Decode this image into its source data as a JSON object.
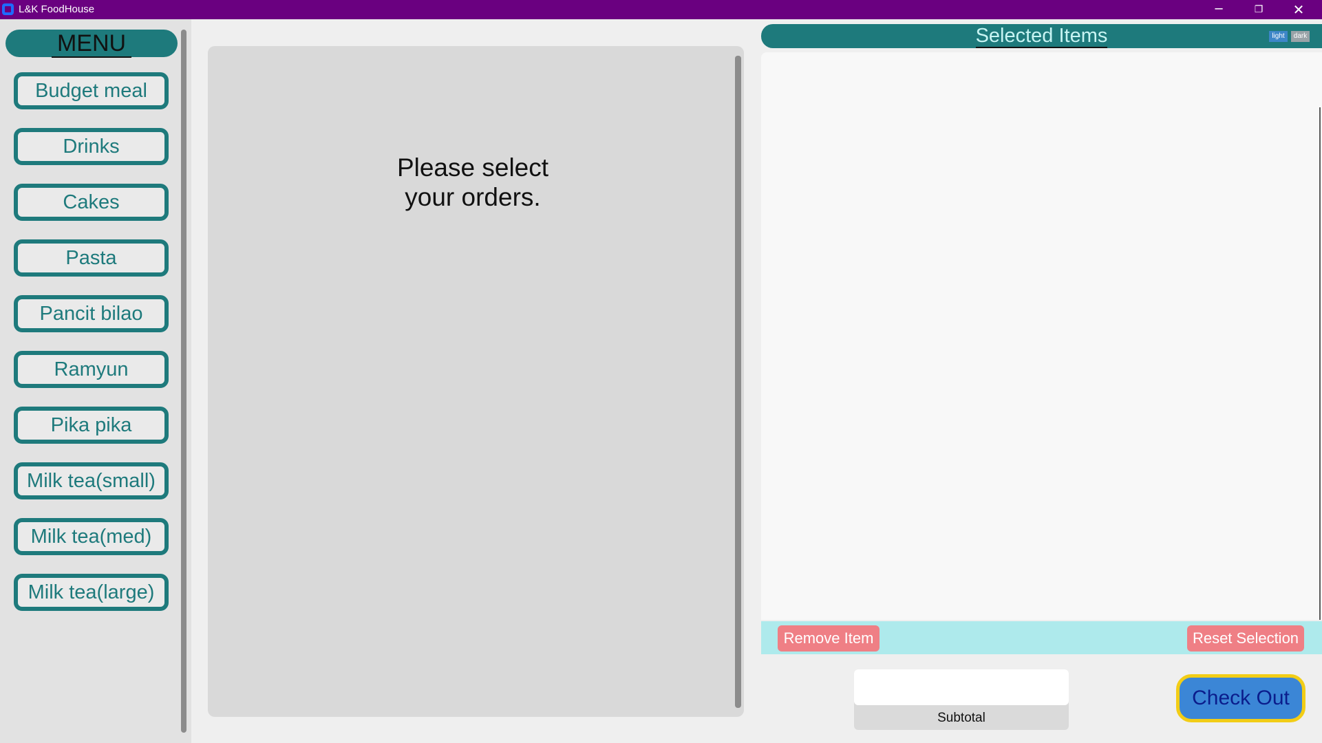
{
  "window": {
    "title": "L&K FoodHouse",
    "controls": {
      "minimize": "─",
      "maximize": "❐",
      "close": "✕"
    }
  },
  "menu": {
    "header": "MENU",
    "items": [
      {
        "label": "Budget meal"
      },
      {
        "label": "Drinks"
      },
      {
        "label": "Cakes"
      },
      {
        "label": "Pasta"
      },
      {
        "label": "Pancit bilao"
      },
      {
        "label": "Ramyun"
      },
      {
        "label": "Pika pika"
      },
      {
        "label": "Milk tea(small)"
      },
      {
        "label": "Milk tea(med)"
      },
      {
        "label": "Milk tea(large)"
      }
    ]
  },
  "main": {
    "placeholder_line1": "Please select",
    "placeholder_line2": "your orders."
  },
  "selected": {
    "title": "Selected Items",
    "mode_light": "light",
    "mode_dark": "dark",
    "remove_label": "Remove Item",
    "reset_label": "Reset Selection"
  },
  "subtotal": {
    "value": "",
    "label": "Subtotal"
  },
  "checkout": {
    "label": "Check Out"
  },
  "colors": {
    "titlebar": "#6a0080",
    "teal": "#1e7a7c",
    "action_bar": "#aeeaec",
    "danger": "#ef7f85",
    "checkout_fill": "#3b86d6",
    "checkout_border": "#f2cd16"
  }
}
